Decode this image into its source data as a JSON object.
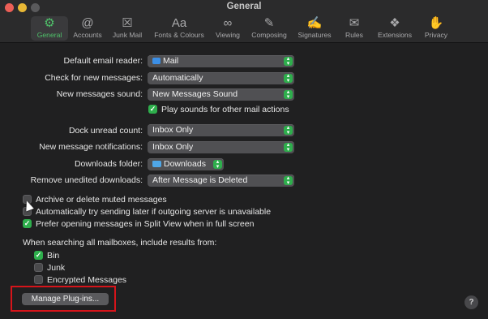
{
  "window": {
    "title": "General"
  },
  "toolbar": {
    "items": [
      {
        "label": "General",
        "icon": "gear-icon",
        "glyph": "⚙",
        "active": true
      },
      {
        "label": "Accounts",
        "icon": "at-icon",
        "glyph": "@",
        "active": false
      },
      {
        "label": "Junk Mail",
        "icon": "junk-tray-icon",
        "glyph": "☒",
        "active": false
      },
      {
        "label": "Fonts & Colours",
        "icon": "fonts-icon",
        "glyph": "Aa",
        "active": false
      },
      {
        "label": "Viewing",
        "icon": "glasses-icon",
        "glyph": "∞",
        "active": false
      },
      {
        "label": "Composing",
        "icon": "compose-icon",
        "glyph": "✎",
        "active": false
      },
      {
        "label": "Signatures",
        "icon": "signature-icon",
        "glyph": "✍",
        "active": false
      },
      {
        "label": "Rules",
        "icon": "rules-icon",
        "glyph": "✉",
        "active": false
      },
      {
        "label": "Extensions",
        "icon": "puzzle-icon",
        "glyph": "❖",
        "active": false
      },
      {
        "label": "Privacy",
        "icon": "hand-icon",
        "glyph": "✋",
        "active": false
      }
    ]
  },
  "settings": {
    "default_email_reader": {
      "label": "Default email reader:",
      "value": "Mail"
    },
    "check_new_messages": {
      "label": "Check for new messages:",
      "value": "Automatically"
    },
    "new_messages_sound": {
      "label": "New messages sound:",
      "value": "New Messages Sound"
    },
    "play_sounds": {
      "label": "Play sounds for other mail actions",
      "checked": true
    },
    "dock_unread_count": {
      "label": "Dock unread count:",
      "value": "Inbox Only"
    },
    "new_message_notifications": {
      "label": "New message notifications:",
      "value": "Inbox Only"
    },
    "downloads_folder": {
      "label": "Downloads folder:",
      "value": "Downloads"
    },
    "remove_unedited_downloads": {
      "label": "Remove unedited downloads:",
      "value": "After Message is Deleted"
    }
  },
  "options": {
    "archive_muted": {
      "label": "Archive or delete muted messages",
      "checked": false
    },
    "send_later": {
      "label": "Automatically try sending later if outgoing server is unavailable",
      "checked": false
    },
    "split_view": {
      "label": "Prefer opening messages in Split View when in full screen",
      "checked": true
    }
  },
  "search": {
    "label": "When searching all mailboxes, include results from:",
    "bin": {
      "label": "Bin",
      "checked": true
    },
    "junk": {
      "label": "Junk",
      "checked": false
    },
    "encrypted": {
      "label": "Encrypted Messages",
      "checked": false
    }
  },
  "buttons": {
    "manage_plugins": "Manage Plug-ins...",
    "help": "?"
  },
  "colors": {
    "accent": "#2eae4c",
    "highlight": "#d6141a",
    "background": "#202021"
  }
}
